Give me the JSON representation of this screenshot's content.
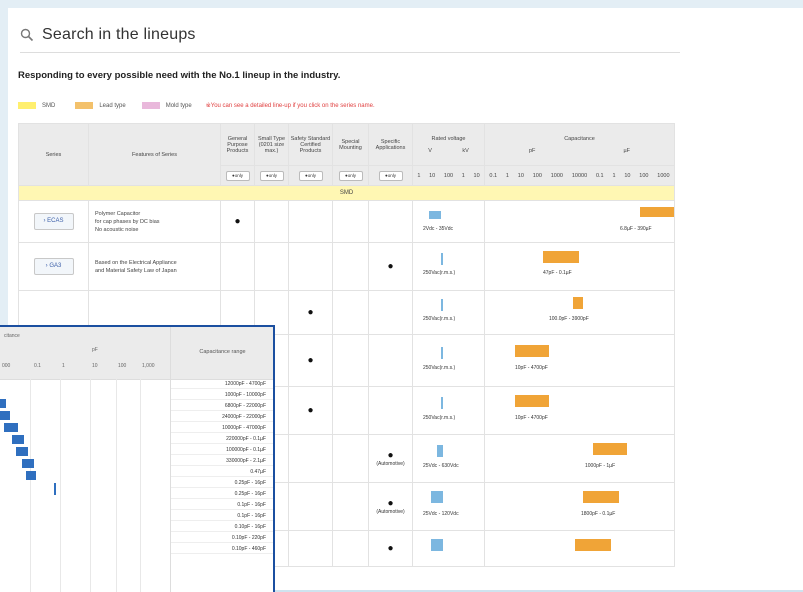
{
  "header": {
    "title": "Search in the lineups",
    "icon": "search-icon"
  },
  "subtitle": "Responding to every possible need with the No.1 lineup in the industry.",
  "legend": [
    {
      "label": "SMD",
      "color": "#ffef6e"
    },
    {
      "label": "Lead type",
      "color": "#f3c16b"
    },
    {
      "label": "Mold type",
      "color": "#e9b8db"
    }
  ],
  "legend_note": "※You can see a detailed line-up if you click on the series name.",
  "table": {
    "headers": {
      "series": "Series",
      "features": "Features of Series",
      "general": "General Purpose Products",
      "small": "Small Type (0201 size max.)",
      "safety": "Safety Standard Certified Products",
      "special": "Special Mounting",
      "specific": "Specific Applications",
      "rated_voltage": "Rated voltage",
      "v": "V",
      "kv": "kV",
      "capacitance": "Capacitance",
      "pf": "pF",
      "uf": "µF",
      "pill": "●only"
    },
    "voltage_ticks": [
      "1",
      "10",
      "100",
      "1",
      "10"
    ],
    "cap_ticks": [
      "0.1",
      "1",
      "10",
      "100",
      "1000",
      "10000",
      "0.1",
      "1",
      "10",
      "100",
      "1000"
    ],
    "section": "SMD",
    "rows": [
      {
        "series": "ECAS",
        "features": [
          "Polymer Capacitor",
          "for cap phases by DC bias",
          "No acoustic noise"
        ],
        "volt": "2Vdc - 35Vdc",
        "cap": "6.8µF - 390µF",
        "app": ""
      },
      {
        "series": "GA3",
        "features": [
          "Based on the Electrical Appliance",
          "and Material Safety Law of Japan"
        ],
        "volt": "250Vac(r.m.s.)",
        "cap": "47pF - 0.1µF",
        "app": ""
      },
      {
        "series": "",
        "features": [],
        "volt": "250Vac(r.m.s.)",
        "cap": "100.0pF - 3900pF",
        "app": ""
      },
      {
        "series": "",
        "features": [],
        "volt": "250Vac(r.m.s.)",
        "cap": "10pF - 4700pF",
        "app": ""
      },
      {
        "series": "",
        "features": [],
        "volt": "250Vac(r.m.s.)",
        "cap": "10pF - 4700pF",
        "app": ""
      },
      {
        "series": "",
        "features": [],
        "volt": "25Vdc - 630Vdc",
        "cap": "1000pF - 1µF",
        "app": "(Automotive)"
      },
      {
        "series": "",
        "features": [],
        "volt": "25Vdc - 120Vdc",
        "cap": "1800pF - 0.1µF",
        "app": "(Automotive)"
      },
      {
        "series": "",
        "features": [],
        "volt": "",
        "cap": "",
        "app": ""
      }
    ]
  },
  "inset": {
    "header_left": "citance",
    "header_pf": "pF",
    "ticks": [
      "000",
      "0.1",
      "1",
      "10",
      "100",
      "1,000"
    ],
    "range_title": "Capacitance range",
    "ranges": [
      "12000pF - 4700pF",
      "1000pF - 10000pF",
      "6800pF - 22000pF",
      "24000pF - 22000pF",
      "10000pF - 47000pF",
      "220000pF - 0.1µF",
      "100000pF - 0.1µF",
      "330000pF - 2.1µF",
      "0.47µF",
      "0.25pF - 16pF",
      "0.25pF - 16pF",
      "0.1pF - 16pF",
      "0.1pF - 16pF",
      "0.10pF - 16pF",
      "0.10pF - 220pF",
      "0.10pF - 460pF"
    ]
  },
  "colors": {
    "smd": "#fff7b3",
    "bar_v": "#7cb7e0",
    "bar_cap": "#f0a437",
    "inset_border": "#1b4fa0",
    "inset_bar": "#2f6fbf"
  }
}
